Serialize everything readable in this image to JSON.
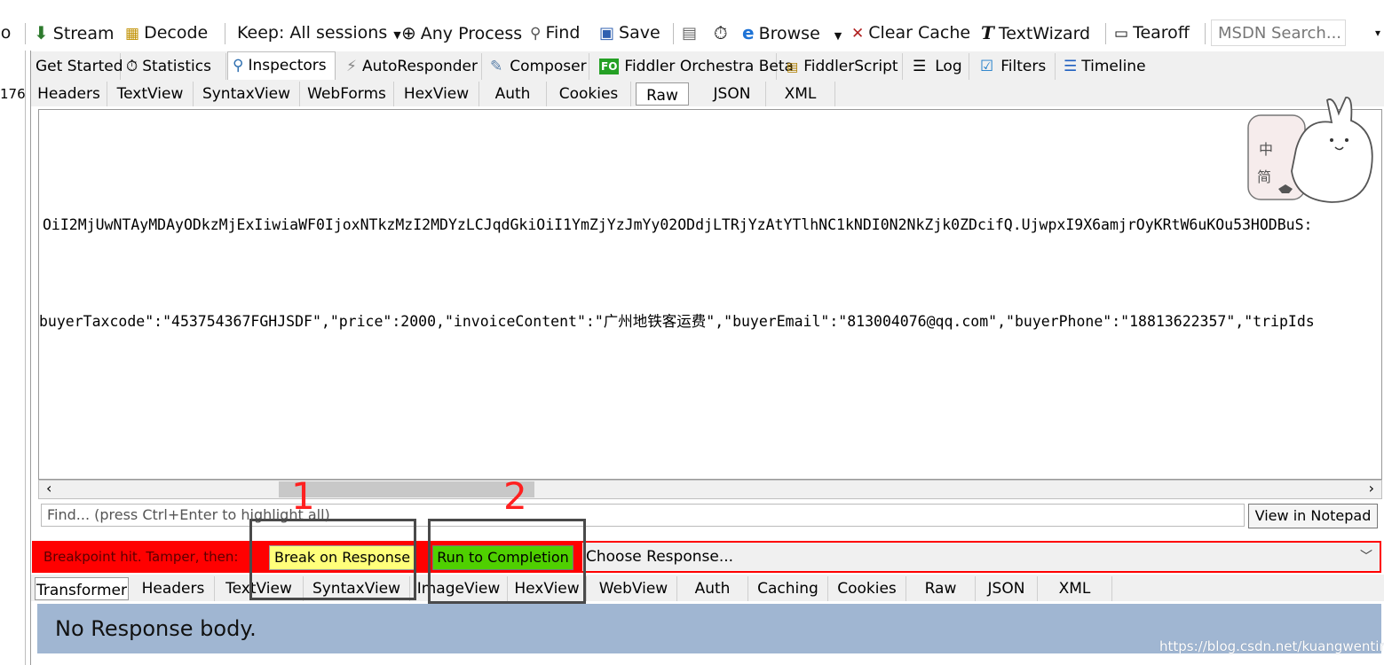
{
  "toolbar": {
    "go": "Go",
    "stream": "Stream",
    "decode": "Decode",
    "keep": "Keep: All sessions",
    "any_process": "Any Process",
    "find": "Find",
    "save": "Save",
    "browse": "Browse",
    "clear_cache": "Clear Cache",
    "textwizard": "TextWizard",
    "tearoff": "Tearoff",
    "msdn_placeholder": "MSDN Search..."
  },
  "left_strip": {
    "fragment": "176"
  },
  "main_tabs": [
    {
      "label": "Get Started"
    },
    {
      "label": "Statistics"
    },
    {
      "label": "Inspectors"
    },
    {
      "label": "AutoResponder"
    },
    {
      "label": "Composer"
    },
    {
      "label": "Fiddler Orchestra Beta"
    },
    {
      "label": "FiddlerScript"
    },
    {
      "label": "Log"
    },
    {
      "label": "Filters"
    },
    {
      "label": "Timeline"
    }
  ],
  "fo_badge": "FO",
  "request_tabs": [
    "Headers",
    "TextView",
    "SyntaxView",
    "WebForms",
    "HexView",
    "Auth",
    "Cookies",
    "Raw",
    "JSON",
    "XML"
  ],
  "request_active_tab": "Raw",
  "raw_lines": {
    "token": "OiI2MjUwNTAyMDAyODkzMjExIiwiaWF0IjoxNTkzMzI2MDYzLCJqdGkiOiI1YmZjYzJmYy02ODdjLTRjYzAtYTlhNC1kNDI0N2NkZjk0ZDcifQ.UjwpxI9X6amjrOyKRtW6uKOu53HODBuS:",
    "json": "buyerTaxcode\":\"453754367FGHJSDF\",\"price\":2000,\"invoiceContent\":\"广州地铁客运费\",\"buyerEmail\":\"813004076@qq.com\",\"buyerPhone\":\"18813622357\",\"tripIds"
  },
  "sticker": {
    "text1": "中",
    "text2": "简"
  },
  "find": {
    "placeholder": "Find... (press Ctrl+Enter to highlight all)",
    "notepad_button": "View in Notepad"
  },
  "breakpoint": {
    "label": "Breakpoint hit. Tamper, then:",
    "break_on_response": "Break on Response",
    "run_to_completion": "Run to Completion",
    "choose_response": "Choose Response..."
  },
  "response_tabs": [
    "Transformer",
    "Headers",
    "TextView",
    "SyntaxView",
    "ImageView",
    "HexView",
    "WebView",
    "Auth",
    "Caching",
    "Cookies",
    "Raw",
    "JSON",
    "XML"
  ],
  "response_active_tab": "Transformer",
  "response_body": "No Response body.",
  "watermark": "https://blog.csdn.net/kuangwenting",
  "annotations": {
    "one": "1",
    "two": "2"
  },
  "colors": {
    "breakpoint_bar": "#ff0000",
    "break_button": "#ffff7a",
    "run_button": "#4fd000",
    "response_panel": "#a0b6d2"
  }
}
